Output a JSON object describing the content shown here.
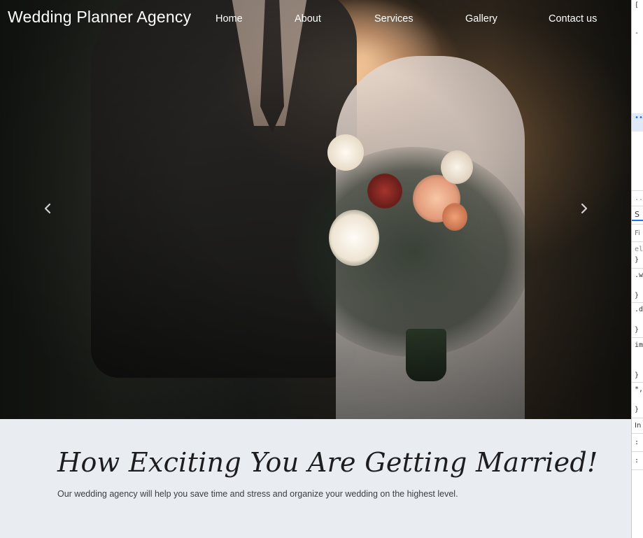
{
  "brand": "Wedding Planner Agency",
  "nav": {
    "home": "Home",
    "about": "About",
    "services": "Services",
    "gallery": "Gallery",
    "contact": "Contact us"
  },
  "carousel": {
    "prev_icon": "chevron-left-icon",
    "next_icon": "chevron-right-icon"
  },
  "intro": {
    "title": "How Exciting You Are Getting Married!",
    "text": "Our wedding agency will help you save time and stress and organize your wedding on the highest level."
  },
  "devtools": {
    "lines": [
      "[",
      "-",
      "•••",
      "..",
      "S",
      "Fi",
      "el",
      "}",
      ".w",
      "}",
      ".d",
      "}",
      "im",
      "}",
      "*,",
      "}",
      "In",
      ":",
      ":"
    ]
  },
  "colors": {
    "intro_bg": "#e9ecf1",
    "nav_text": "#ffffff",
    "title_text": "#1d1d1f"
  }
}
